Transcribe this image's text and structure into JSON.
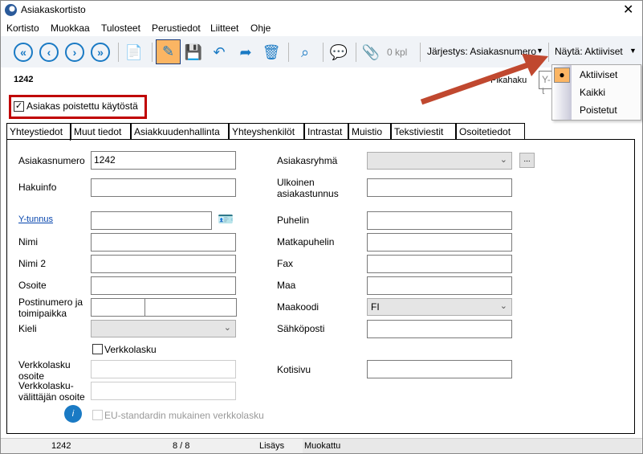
{
  "window": {
    "title": "Asiakaskortisto",
    "close": "✕"
  },
  "menu": [
    "Kortisto",
    "Muokkaa",
    "Tulosteet",
    "Perustiedot",
    "Liitteet",
    "Ohje"
  ],
  "toolbar": {
    "attachments": "0 kpl",
    "sort": "Järjestys: Asiakasnumero",
    "show": "Näytä: Aktiiviset",
    "show_options": [
      "Aktiiviset",
      "Kaikki",
      "Poistetut"
    ],
    "show_selected": "Aktiiviset"
  },
  "header": {
    "record_id": "1242",
    "quick_search_label": "Pikahaku",
    "quick_search_value": "Y-t"
  },
  "deleted_checkbox": {
    "label": "Asiakas poistettu käytöstä",
    "checked": true
  },
  "tabs": [
    "Yhteystiedot",
    "Muut tiedot",
    "Asiakkuudenhallinta",
    "Yhteyshenkilöt",
    "Intrastat",
    "Muistio",
    "Tekstiviestit",
    "Osoitetiedot"
  ],
  "active_tab": "Yhteystiedot",
  "form": {
    "asiakasnumero": {
      "label": "Asiakasnumero",
      "value": "1242"
    },
    "hakuinfo": {
      "label": "Hakuinfo",
      "value": ""
    },
    "ytunnus": {
      "label": "Y-tunnus",
      "value": ""
    },
    "nimi": {
      "label": "Nimi",
      "value": ""
    },
    "nimi2": {
      "label": "Nimi 2",
      "value": ""
    },
    "osoite": {
      "label": "Osoite",
      "value": ""
    },
    "postinumero": {
      "label": "Postinumero ja toimipaikka",
      "value": ""
    },
    "kieli": {
      "label": "Kieli",
      "value": ""
    },
    "verkkolasku": {
      "label": "Verkkolasku",
      "checked": false
    },
    "verkkolasku_osoite": {
      "label": "Verkkolasku osoite",
      "value": ""
    },
    "valittaja": {
      "label": "Verkkolasku-välittäjän osoite",
      "value": ""
    },
    "eu": {
      "label": "EU-standardin mukainen verkkolasku",
      "checked": false
    },
    "asiakasryhma": {
      "label": "Asiakasryhmä",
      "value": "",
      "button": "..."
    },
    "ulkoinen": {
      "label": "Ulkoinen asiakastunnus",
      "value": ""
    },
    "puhelin": {
      "label": "Puhelin",
      "value": ""
    },
    "matkapuhelin": {
      "label": "Matkapuhelin",
      "value": ""
    },
    "fax": {
      "label": "Fax",
      "value": ""
    },
    "maa": {
      "label": "Maa",
      "value": ""
    },
    "maakoodi": {
      "label": "Maakoodi",
      "value": "FI"
    },
    "sahkoposti": {
      "label": "Sähköposti",
      "value": ""
    },
    "kotisivu": {
      "label": "Kotisivu",
      "value": ""
    }
  },
  "status": {
    "id": "1242",
    "position": "8 / 8",
    "mode": "Lisäys",
    "state": "Muokattu"
  },
  "colors": {
    "accent": "#1a7ac4",
    "highlight_box": "#c00000",
    "arrow": "#c0482f",
    "active_button": "#fbb563"
  }
}
